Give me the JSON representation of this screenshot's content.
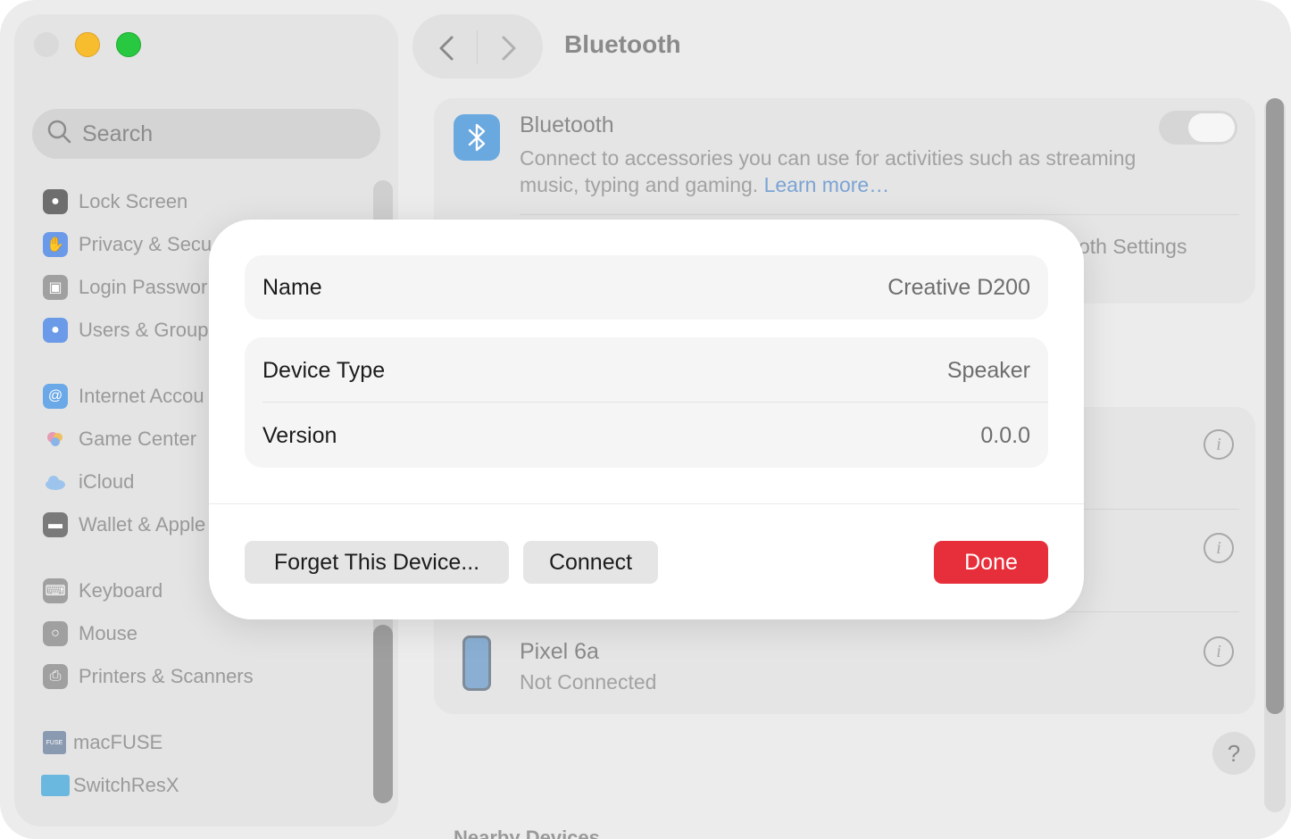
{
  "window": {
    "title": "Bluetooth"
  },
  "sidebar": {
    "search_placeholder": "Search",
    "items": [
      {
        "label": "Lock Screen",
        "icon": "lock-icon",
        "color": "#6e6e6e"
      },
      {
        "label": "Privacy & Secu",
        "icon": "hand-icon",
        "color": "#4a7fe0"
      },
      {
        "label": "Login Passwor",
        "icon": "padlock-icon",
        "color": "#8e8e8e"
      },
      {
        "label": "Users & Group",
        "icon": "users-icon",
        "color": "#4a7fe0"
      },
      {
        "label": "Internet Accou",
        "icon": "at-icon",
        "color": "#4a9be0"
      },
      {
        "label": "Game Center",
        "icon": "game-center-icon",
        "color": "#e07a9b"
      },
      {
        "label": "iCloud",
        "icon": "cloud-icon",
        "color": "#7ab0e8"
      },
      {
        "label": "Wallet & Apple",
        "icon": "wallet-icon",
        "color": "#6e6e6e"
      },
      {
        "label": "Keyboard",
        "icon": "keyboard-icon",
        "color": "#8e8e8e"
      },
      {
        "label": "Mouse",
        "icon": "mouse-icon",
        "color": "#8e8e8e"
      },
      {
        "label": "Printers & Scanners",
        "icon": "printer-icon",
        "color": "#8e8e8e"
      },
      {
        "label": "macFUSE",
        "icon": "macfuse-icon",
        "color": "#7a8aa0"
      },
      {
        "label": "SwitchResX",
        "icon": "monitor-icon",
        "color": "#5ab0d8"
      }
    ]
  },
  "bluetooth": {
    "title": "Bluetooth",
    "description": "Connect to accessories you can use for activities such as streaming music, typing and gaming.",
    "learn_more": "Learn more…",
    "enabled": true,
    "settings_label": "oth Settings"
  },
  "devices": [
    {
      "name": "Pixel 6a",
      "status": "Not Connected",
      "icon": "phone-icon"
    }
  ],
  "nearby_label": "Nearby Devices",
  "help_label": "?",
  "dialog": {
    "name_label": "Name",
    "name_value": "Creative D200",
    "device_type_label": "Device Type",
    "device_type_value": "Speaker",
    "version_label": "Version",
    "version_value": "0.0.0",
    "forget_label": "Forget This Device...",
    "connect_label": "Connect",
    "done_label": "Done"
  },
  "colors": {
    "accent_done": "#e72f3b",
    "link": "#7aa3d4",
    "bluetooth_icon": "#6aa8e0"
  }
}
